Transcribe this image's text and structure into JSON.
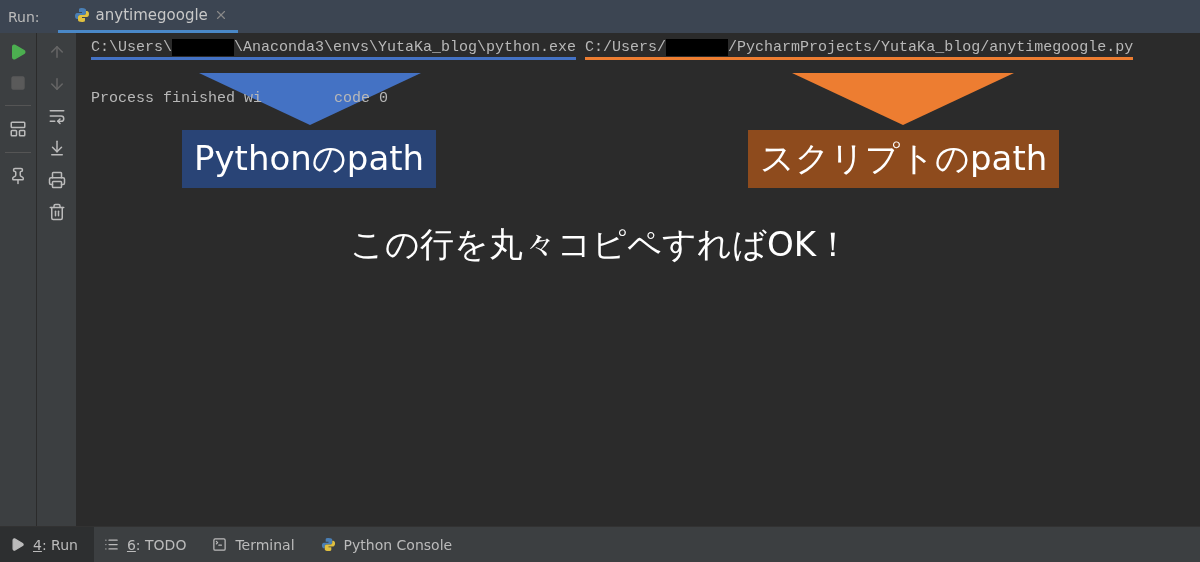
{
  "run_bar": {
    "label": "Run:",
    "tabs": [
      {
        "label": "anytimegoogle",
        "selected": true
      }
    ]
  },
  "console": {
    "command": {
      "python_path": {
        "before": "C:\\Users\\",
        "after": "\\Anaconda3\\envs\\YutaKa_blog\\python.exe",
        "color": "#4472c4"
      },
      "script_path": {
        "before": "C:/Users/",
        "after": "/PycharmProjects/YutaKa_blog/anytimegoogle.py",
        "color": "#ed7d31"
      }
    },
    "status": {
      "before": "Process finished wi",
      "after": "code 0"
    }
  },
  "annotations": [
    {
      "label": "Pythonのpath",
      "color": "#4472c4"
    },
    {
      "label": "スクリプトのpath",
      "color": "#ed7d31"
    }
  ],
  "note": "この行を丸々コピペすればOK！",
  "bottom_tabs": [
    {
      "mnemonic": "4",
      "label": ": Run",
      "kind": "run",
      "selected": true
    },
    {
      "mnemonic": "6",
      "label": ": TODO",
      "kind": "todo",
      "selected": false
    },
    {
      "label": "Terminal",
      "kind": "terminal",
      "selected": false
    },
    {
      "label": "Python Console",
      "kind": "python",
      "selected": false
    }
  ]
}
